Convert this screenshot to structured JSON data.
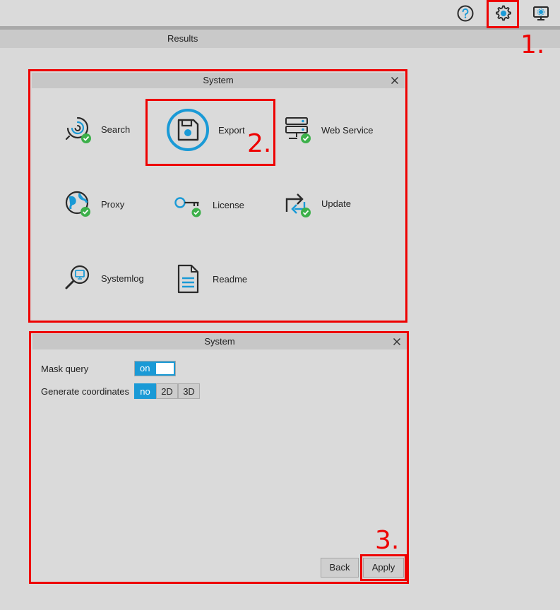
{
  "toolbar": {
    "help_icon": "question-circle-icon",
    "settings_icon": "gear-icon",
    "monitor_icon": "monitor-gear-icon"
  },
  "results_tab": {
    "label": "Results"
  },
  "system_menu": {
    "title": "System",
    "items": [
      {
        "label": "Search",
        "icon": "search-spiral-icon"
      },
      {
        "label": "Export",
        "icon": "floppy-disk-icon"
      },
      {
        "label": "Web Service",
        "icon": "server-icon"
      },
      {
        "label": "Proxy",
        "icon": "globe-icon"
      },
      {
        "label": "License",
        "icon": "key-icon"
      },
      {
        "label": "Update",
        "icon": "update-arrows-icon"
      },
      {
        "label": "Systemlog",
        "icon": "magnifier-monitor-icon"
      },
      {
        "label": "Readme",
        "icon": "document-icon"
      }
    ]
  },
  "export_settings": {
    "title": "System",
    "mask_query": {
      "label": "Mask query",
      "value": "on"
    },
    "generate_coordinates": {
      "label": "Generate coordinates",
      "options": [
        "no",
        "2D",
        "3D"
      ],
      "selected": "no"
    },
    "back_label": "Back",
    "apply_label": "Apply"
  },
  "annotations": [
    "1.",
    "2.",
    "3."
  ],
  "colors": {
    "accent": "#1a9ad6",
    "highlight": "#ee0000",
    "check": "#3cb04a"
  }
}
